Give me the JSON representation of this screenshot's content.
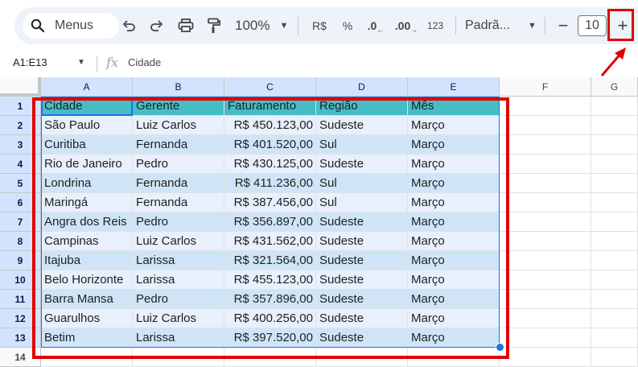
{
  "toolbar": {
    "search_label": "Menus",
    "zoom": "100%",
    "currency": "R$",
    "percent": "%",
    "decrease_decimals": ".0",
    "increase_decimals": ".00",
    "number_format": "123",
    "font": "Padrã...",
    "font_size": "10",
    "minus": "−",
    "plus": "+"
  },
  "formula_bar": {
    "name_box": "A1:E13",
    "fx": "fx",
    "value": "Cidade"
  },
  "columns": [
    "A",
    "B",
    "C",
    "D",
    "E",
    "F",
    "G"
  ],
  "rows": [
    "1",
    "2",
    "3",
    "4",
    "5",
    "6",
    "7",
    "8",
    "9",
    "10",
    "11",
    "12",
    "13",
    "14"
  ],
  "table": [
    [
      "Cidade",
      "Gerente",
      "Faturamento",
      "Região",
      "Mês"
    ],
    [
      "São Paulo",
      "Luiz Carlos",
      "R$ 450.123,00",
      "Sudeste",
      "Março"
    ],
    [
      "Curitiba",
      "Fernanda",
      "R$ 401.520,00",
      "Sul",
      "Março"
    ],
    [
      "Rio de Janeiro",
      "Pedro",
      "R$ 430.125,00",
      "Sudeste",
      "Março"
    ],
    [
      "Londrina",
      "Fernanda",
      "R$ 411.236,00",
      "Sul",
      "Março"
    ],
    [
      "Maringá",
      "Fernanda",
      "R$ 387.456,00",
      "Sul",
      "Março"
    ],
    [
      "Angra dos Reis",
      "Pedro",
      "R$ 356.897,00",
      "Sudeste",
      "Março"
    ],
    [
      "Campinas",
      "Luiz Carlos",
      "R$ 431.562,00",
      "Sudeste",
      "Março"
    ],
    [
      "Itajuba",
      "Larissa",
      "R$ 321.564,00",
      "Sudeste",
      "Março"
    ],
    [
      "Belo Horizonte",
      "Larissa",
      "R$ 455.123,00",
      "Sudeste",
      "Março"
    ],
    [
      "Barra Mansa",
      "Pedro",
      "R$ 357.896,00",
      "Sudeste",
      "Março"
    ],
    [
      "Guarulhos",
      "Luiz Carlos",
      "R$ 400.256,00",
      "Sudeste",
      "Março"
    ],
    [
      "Betim",
      "Larissa",
      "R$ 397.520,00",
      "Sudeste",
      "Março"
    ]
  ],
  "colors": {
    "header_fill": "#46bdc6",
    "light_row": "#e8f0fd",
    "band_row": "#cfe5f7",
    "selection": "#1a73e8",
    "annotation": "#e00000"
  }
}
